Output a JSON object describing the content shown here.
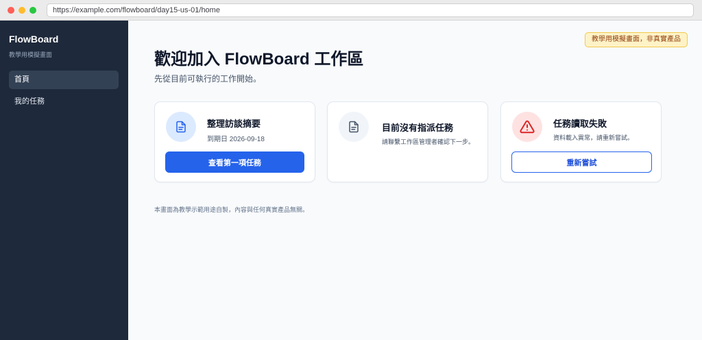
{
  "browser": {
    "url": "https://example.com/flowboard/day15-us-01/home"
  },
  "sidebar": {
    "brand": "FlowBoard",
    "brand_sub": "教學用模擬畫面",
    "items": [
      {
        "label": "首頁",
        "active": true
      },
      {
        "label": "我的任務",
        "active": false
      }
    ]
  },
  "main": {
    "badge": "教學用模擬畫面，非真實產品",
    "title": "歡迎加入 FlowBoard 工作區",
    "subtitle": "先從目前可執行的工作開始。",
    "cards": [
      {
        "icon": "document-icon",
        "title": "整理訪談摘要",
        "meta": "到期日 2026-09-18",
        "button": "查看第一項任務"
      },
      {
        "icon": "document-icon",
        "title": "目前沒有指派任務",
        "meta": "請聯繫工作區管理者確認下一步。"
      },
      {
        "icon": "warning-icon",
        "title": "任務讀取失敗",
        "meta": "資料載入異常，請重新嘗試。",
        "button": "重新嘗試"
      }
    ],
    "footnote": "本畫面為教學示範用途自製，內容與任何真實產品無關。"
  },
  "colors": {
    "sidebar_bg": "#1e293b",
    "primary": "#2563eb",
    "badge_bg": "#fef3c7",
    "error": "#dc2626"
  }
}
